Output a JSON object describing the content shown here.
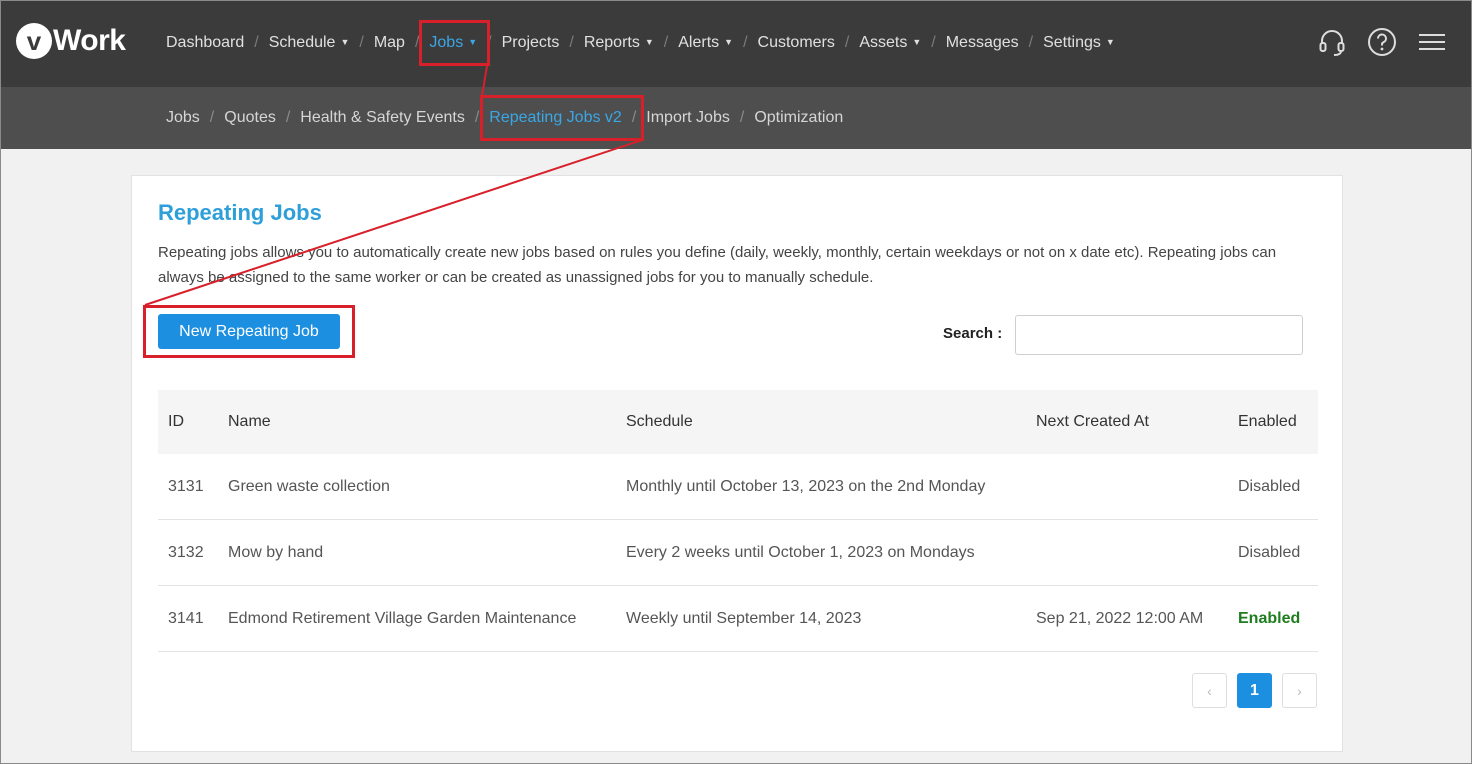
{
  "app": {
    "logo_letter": "v",
    "logo_text": "Work"
  },
  "main_nav": [
    {
      "label": "Dashboard",
      "dropdown": false,
      "active": false
    },
    {
      "label": "Schedule",
      "dropdown": true,
      "active": false
    },
    {
      "label": "Map",
      "dropdown": false,
      "active": false
    },
    {
      "label": "Jobs",
      "dropdown": true,
      "active": true
    },
    {
      "label": "Projects",
      "dropdown": false,
      "active": false
    },
    {
      "label": "Reports",
      "dropdown": true,
      "active": false
    },
    {
      "label": "Alerts",
      "dropdown": true,
      "active": false
    },
    {
      "label": "Customers",
      "dropdown": false,
      "active": false
    },
    {
      "label": "Assets",
      "dropdown": true,
      "active": false
    },
    {
      "label": "Messages",
      "dropdown": false,
      "active": false
    },
    {
      "label": "Settings",
      "dropdown": true,
      "active": false
    }
  ],
  "nav_icons": [
    "headset-icon",
    "help-icon",
    "menu-icon"
  ],
  "sub_nav": [
    {
      "label": "Jobs",
      "active": false
    },
    {
      "label": "Quotes",
      "active": false
    },
    {
      "label": "Health & Safety Events",
      "active": false
    },
    {
      "label": "Repeating Jobs v2",
      "active": true
    },
    {
      "label": "Import Jobs",
      "active": false
    },
    {
      "label": "Optimization",
      "active": false
    }
  ],
  "page": {
    "title": "Repeating Jobs",
    "description": "Repeating jobs allows you to automatically create new jobs based on rules you define (daily, weekly, monthly, certain weekdays or not on x date etc). Repeating jobs can always be assigned to the same worker or can be created as unassigned jobs for you to manually schedule.",
    "new_button": "New Repeating Job",
    "search_label": "Search :",
    "search_value": ""
  },
  "table": {
    "headers": {
      "id": "ID",
      "name": "Name",
      "schedule": "Schedule",
      "next": "Next Created At",
      "enabled": "Enabled"
    },
    "rows": [
      {
        "id": "3131",
        "name": "Green waste collection",
        "schedule": "Monthly until October 13, 2023 on the 2nd Monday",
        "next": "",
        "enabled": "Disabled",
        "is_enabled": false
      },
      {
        "id": "3132",
        "name": "Mow by hand",
        "schedule": "Every 2 weeks until October 1, 2023 on Mondays",
        "next": "",
        "enabled": "Disabled",
        "is_enabled": false
      },
      {
        "id": "3141",
        "name": "Edmond Retirement Village Garden Maintenance",
        "schedule": "Weekly until September 14, 2023",
        "next": "Sep 21, 2022 12:00 AM",
        "enabled": "Enabled",
        "is_enabled": true
      }
    ]
  },
  "pagination": {
    "prev": "‹",
    "current": "1",
    "next": "›"
  },
  "colors": {
    "accent": "#1c8fe0",
    "active_link": "#3aa7e6",
    "enabled_green": "#1e7d1e",
    "highlight_red": "#d8202a"
  }
}
